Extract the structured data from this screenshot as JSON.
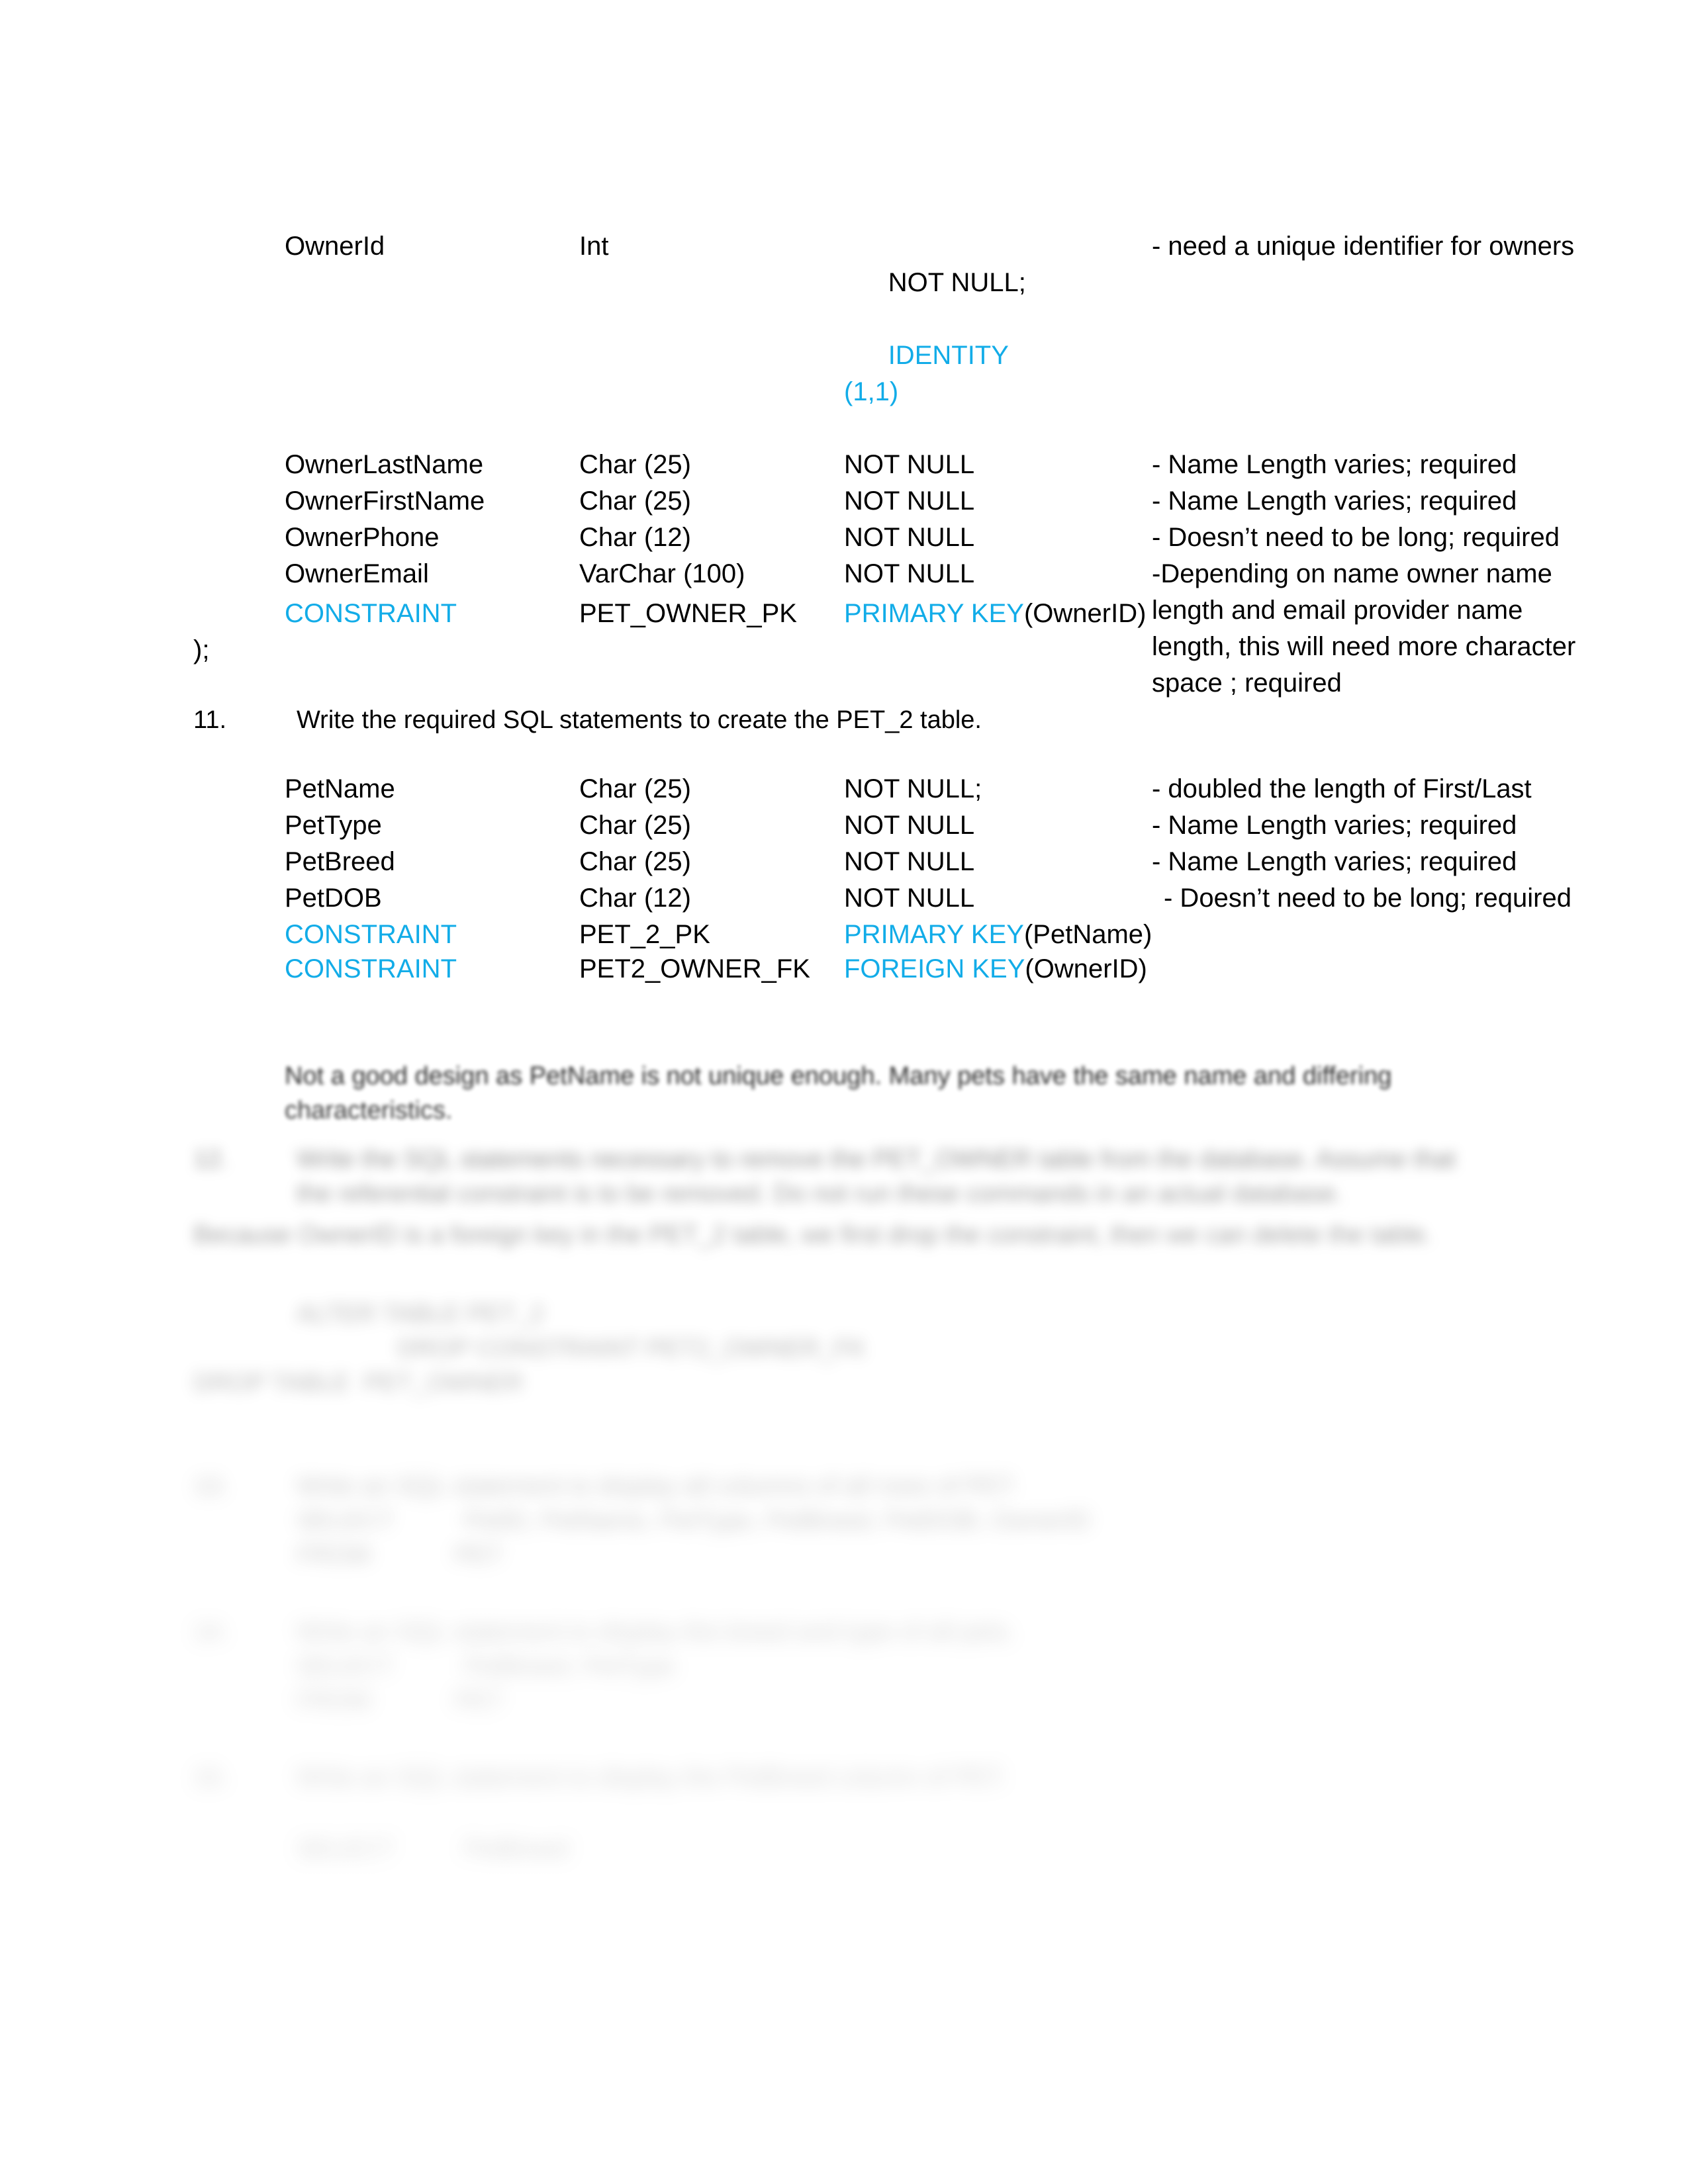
{
  "document": {
    "pet_owner_table": {
      "rows": [
        {
          "column": "OwnerId",
          "type": "Int",
          "constraint": "NOT NULL;",
          "constraint_extra": "IDENTITY\n(1,1)",
          "comment": "- need a unique identifier for owners"
        },
        {
          "column": "OwnerLastName",
          "type": "Char (25)",
          "constraint": "NOT NULL",
          "constraint_extra": "",
          "comment": "- Name Length varies; required"
        },
        {
          "column": "OwnerFirstName",
          "type": "Char (25)",
          "constraint": "NOT NULL",
          "constraint_extra": "",
          "comment": "- Name Length varies; required"
        },
        {
          "column": "OwnerPhone",
          "type": "Char (12)",
          "constraint": "NOT NULL",
          "constraint_extra": "",
          "comment": "- Doesn’t need to be long; required"
        },
        {
          "column": "OwnerEmail",
          "type": "VarChar (100)",
          "constraint": "NOT NULL",
          "constraint_extra": "",
          "comment": "-Depending on name owner name length and email provider name length, this will need more character space ; required"
        }
      ],
      "constraint_row": {
        "keyword": "CONSTRAINT",
        "name": "PET_OWNER_PK",
        "key_type": "PRIMARY KEY",
        "key_columns": "(OwnerID)"
      },
      "closing": ");"
    },
    "question_11": {
      "number": "11.",
      "text": "Write the required SQL statements to create the PET_2 table."
    },
    "pet_2_table": {
      "rows": [
        {
          "column": "PetName",
          "type": "Char (25)",
          "constraint": "NOT NULL;",
          "comment": "- doubled the length of First/Last"
        },
        {
          "column": "PetType",
          "type": "Char (25)",
          "constraint": "NOT NULL",
          "comment": "- Name Length varies; required"
        },
        {
          "column": "PetBreed",
          "type": "Char (25)",
          "constraint": "NOT NULL",
          "comment": "- Name Length varies; required"
        },
        {
          "column": "PetDOB",
          "type": "Char (12)",
          "constraint": "NOT NULL",
          "comment": "- Doesn’t need to be long; required"
        }
      ],
      "constraint_rows": [
        {
          "keyword": "CONSTRAINT",
          "name": "PET_2_PK",
          "key_type": "PRIMARY KEY",
          "key_columns": "(PetName)"
        },
        {
          "keyword": "CONSTRAINT",
          "name": "PET2_OWNER_FK",
          "key_type": "FOREIGN KEY",
          "key_columns": "(OwnerID)"
        }
      ]
    },
    "note": "Not a good design as PetName is not unique enough. Many pets have the same name and differing characteristics.",
    "question_12": {
      "number": "12.",
      "text": "Write the SQL statements necessary to remove the PET_OWNER table from the database. Assume that the referential constraint is to be removed. Do not run these commands in an actual database.",
      "answer_intro": "Because OwnerID is a foreign key in the PET_2 table, we first drop the constraint, then we can delete the table.",
      "code_lines": [
        "ALTER TABLE PET_2",
        "DROP CONSTRAINT PET2_OWNER_FK",
        "DROP TABLE  PET_OWNER"
      ]
    },
    "question_13": {
      "number": "13.",
      "text": "Write an SQL statement to display all columns of all rows of PET.",
      "code_lines": [
        "SELECT          PetID, PetName, PetType, PetBreed, PetDOB, OwnerID",
        "FROM            PET"
      ]
    },
    "question_14": {
      "number": "14.",
      "text": "Write an SQL statement to display the breed and type of all pets.",
      "code_lines": [
        "SELECT          PetBreed, PetType",
        "FROM            PET"
      ]
    },
    "question_15": {
      "number": "15.",
      "text": "Write an SQL statement to display the PetBreed column of PET.",
      "code_lines": [
        "SELECT          PetBreed"
      ]
    },
    "colors": {
      "keyword_cyan": "#12ACE8",
      "body_black": "#000000",
      "page_background": "#ffffff"
    }
  }
}
